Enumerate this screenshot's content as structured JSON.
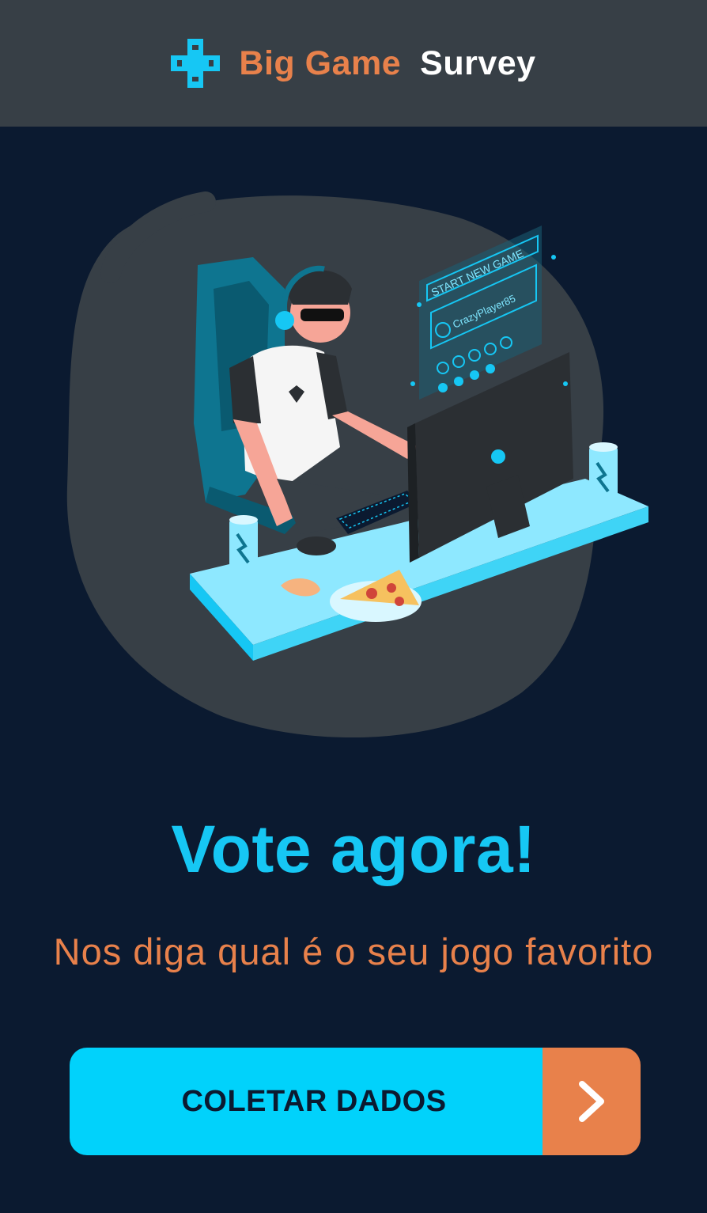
{
  "header": {
    "brand_first": "Big Game",
    "brand_second": "Survey",
    "icon": "gamepad-cross-icon"
  },
  "illustration": {
    "name": "gamer-at-desk-illustration",
    "screen_lines": [
      "START NEW GAME",
      "CrazyPlayer85"
    ]
  },
  "main": {
    "title": "Vote agora!",
    "subtitle": "Nos diga qual é o seu jogo favorito"
  },
  "cta": {
    "label": "COLETAR DADOS",
    "icon": "chevron-right-icon"
  },
  "colors": {
    "background": "#0b1a30",
    "header": "#373f46",
    "accent_cyan": "#01d2fb",
    "accent_orange": "#e8814b"
  }
}
